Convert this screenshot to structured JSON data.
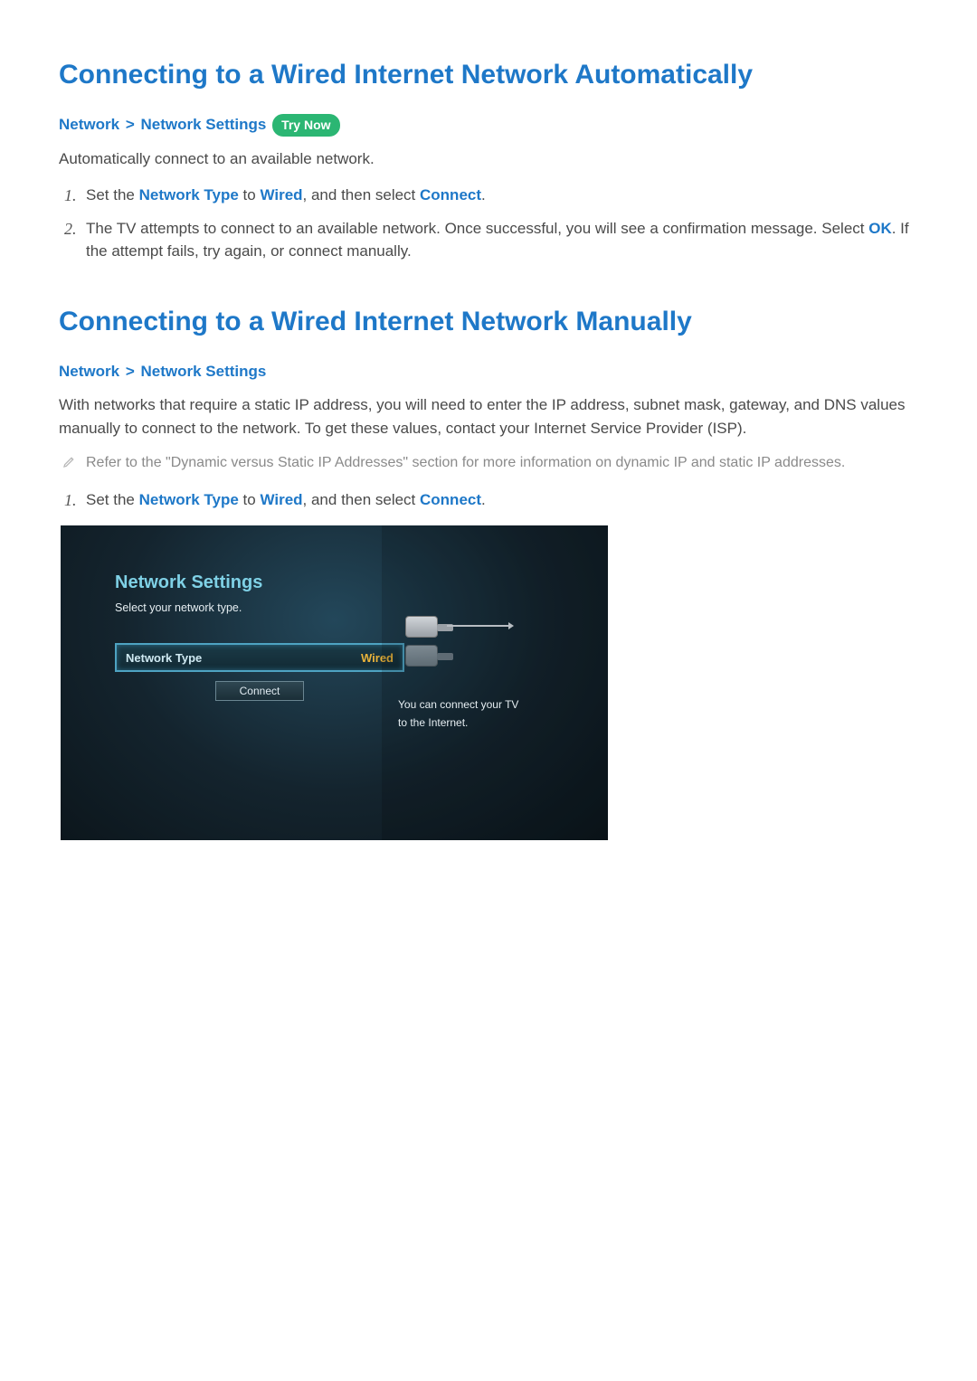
{
  "section1": {
    "heading": "Connecting to a Wired Internet Network Automatically",
    "breadcrumb": {
      "a": "Network",
      "sep": ">",
      "b": "Network Settings"
    },
    "try_now": "Try Now",
    "intro": "Automatically connect to an available network.",
    "steps": [
      {
        "pre": "Set the ",
        "kw1": "Network Type",
        "mid1": " to ",
        "kw2": "Wired",
        "mid2": ", and then select ",
        "kw3": "Connect",
        "post": "."
      },
      {
        "pre": "The TV attempts to connect to an available network. Once successful, you will see a confirmation message. Select ",
        "kw1": "OK",
        "post": ". If the attempt fails, try again, or connect manually."
      }
    ]
  },
  "section2": {
    "heading": "Connecting to a Wired Internet Network Manually",
    "breadcrumb": {
      "a": "Network",
      "sep": ">",
      "b": "Network Settings"
    },
    "intro": "With networks that require a static IP address, you will need to enter the IP address, subnet mask, gateway, and DNS values manually to connect to the network. To get these values, contact your Internet Service Provider (ISP).",
    "note": "Refer to the \"Dynamic versus Static IP Addresses\" section for more information on dynamic IP and static IP addresses.",
    "steps": [
      {
        "pre": "Set the ",
        "kw1": "Network Type",
        "mid1": " to ",
        "kw2": "Wired",
        "mid2": ", and then select ",
        "kw3": "Connect",
        "post": "."
      }
    ]
  },
  "tv": {
    "title": "Network Settings",
    "subtitle": "Select your network type.",
    "row_label": "Network Type",
    "row_value": "Wired",
    "connect": "Connect",
    "caption_l1": "You can connect your TV",
    "caption_l2": "to the Internet."
  }
}
